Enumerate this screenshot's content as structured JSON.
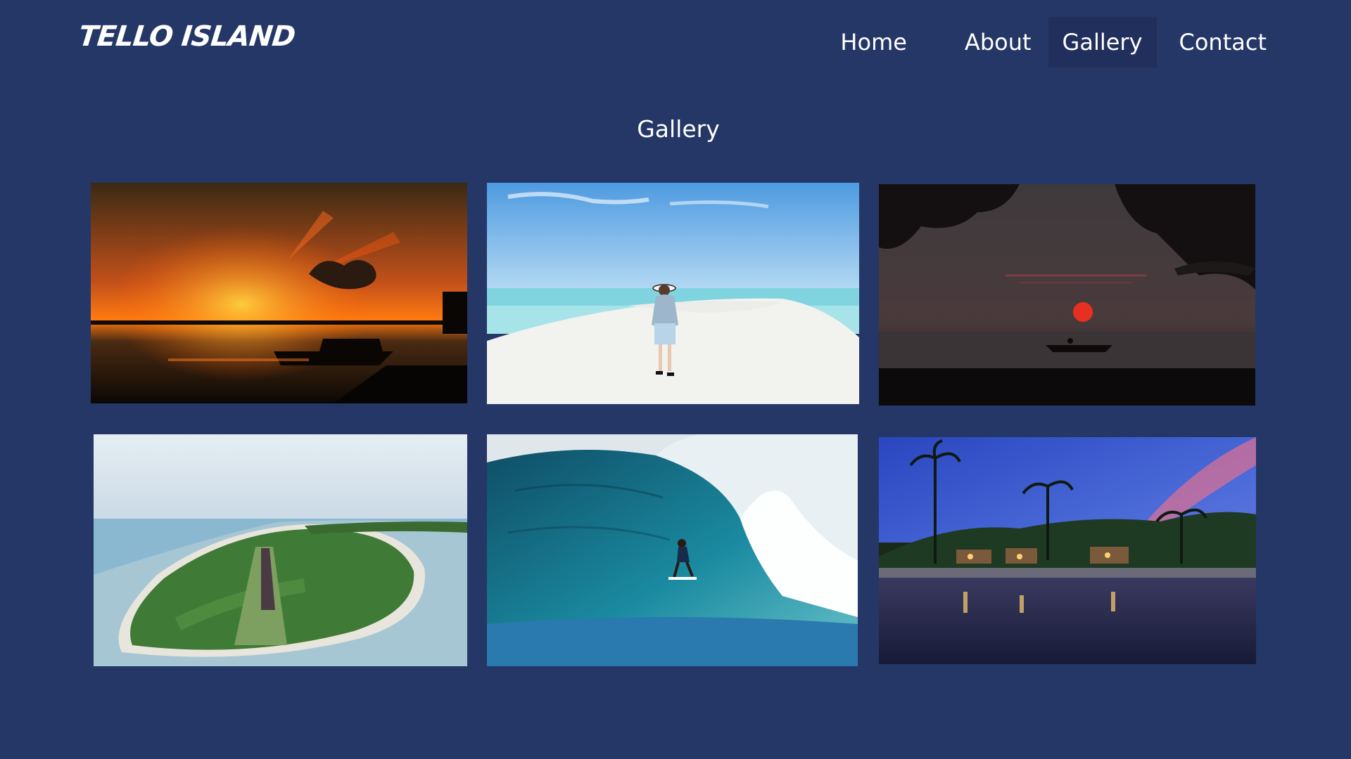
{
  "header": {
    "logo_text": "TELLO ISLAND",
    "nav": [
      {
        "label": "Home",
        "active": false
      },
      {
        "label": "About",
        "active": false
      },
      {
        "label": "Gallery",
        "active": true
      },
      {
        "label": "Contact",
        "active": false
      }
    ]
  },
  "main": {
    "title": "Gallery",
    "photos": [
      {
        "subject": "orange sunset over water with boat silhouettes"
      },
      {
        "subject": "woman in sun hat standing on white sandbar"
      },
      {
        "subject": "red sun setting behind canoe silhouette"
      },
      {
        "subject": "aerial view of island with airstrip"
      },
      {
        "subject": "surfer riding inside a barrel wave"
      },
      {
        "subject": "palm trees and resort lights at dusk reflected in water"
      }
    ]
  },
  "colors": {
    "background": "#243766",
    "active_nav_background": "#202f5c",
    "text": "#ffffff"
  }
}
